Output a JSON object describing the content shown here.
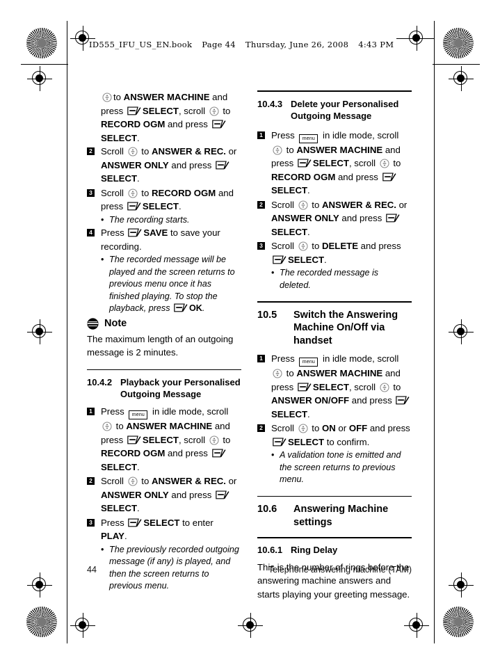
{
  "header": {
    "filename": "ID555_IFU_US_EN.book",
    "page_label": "Page 44",
    "day": "Thursday, June 26, 2008",
    "time": "4:43 PM"
  },
  "footer": {
    "page_number": "44",
    "chapter_title": "Telephone answering machine (TAM)"
  },
  "icons": {
    "scroll": "scroll-key-icon",
    "softkey": "soft-key-icon",
    "menu": "menu-key-icon",
    "menu_label": "menu",
    "note": "note-icon"
  },
  "left_column": {
    "continued_step": {
      "part1": "to ",
      "b1": "ANSWER MACHINE",
      "part2": " and press ",
      "b2": "SELECT",
      "part3": ", scroll ",
      "part4": " to ",
      "b3": "RECORD OGM",
      "part5": " and press ",
      "b4": "SELECT",
      "part6": "."
    },
    "steps": [
      {
        "num": "2",
        "segments": [
          {
            "t": "Scroll ",
            "bold": false
          },
          {
            "t": "ICON_SCROLL",
            "bold": false
          },
          {
            "t": " to ",
            "bold": false
          },
          {
            "t": "ANSWER & REC.",
            "bold": true
          },
          {
            "t": " or ",
            "bold": false
          },
          {
            "t": "ANSWER ONLY",
            "bold": true
          },
          {
            "t": " and press ",
            "bold": false
          },
          {
            "t": "ICON_SOFT",
            "bold": false
          },
          {
            "t": "SELECT",
            "bold": true
          },
          {
            "t": ".",
            "bold": false
          }
        ]
      },
      {
        "num": "3",
        "segments": [
          {
            "t": "Scroll ",
            "bold": false
          },
          {
            "t": "ICON_SCROLL",
            "bold": false
          },
          {
            "t": " to ",
            "bold": false
          },
          {
            "t": "RECORD OGM",
            "bold": true
          },
          {
            "t": " and press ",
            "bold": false
          },
          {
            "t": "ICON_SOFT",
            "bold": false
          },
          {
            "t": "SELECT",
            "bold": true
          },
          {
            "t": ".",
            "bold": false
          }
        ],
        "bullets": [
          "The recording starts."
        ]
      },
      {
        "num": "4",
        "segments": [
          {
            "t": "Press ",
            "bold": false
          },
          {
            "t": "ICON_SOFT",
            "bold": false
          },
          {
            "t": "SAVE",
            "bold": true
          },
          {
            "t": " to save your recording.",
            "bold": false
          }
        ],
        "bullets": []
      }
    ],
    "bullet_save": {
      "pre": "The recorded message will be played and the screen returns to previous menu once it has finished playing. To stop the playback, press ",
      "bold": "OK",
      "post": "."
    },
    "note": {
      "title": "Note",
      "body": "The maximum length of an outgoing message is 2 minutes."
    },
    "section_10_4_2": {
      "number": "10.4.2",
      "title": "Playback your Personalised Outgoing Message",
      "steps": [
        {
          "num": "1",
          "segments": [
            {
              "t": "Press ",
              "bold": false
            },
            {
              "t": "ICON_MENU",
              "bold": false
            },
            {
              "t": " in idle mode, scroll ",
              "bold": false
            },
            {
              "t": "ICON_SCROLL",
              "bold": false
            },
            {
              "t": " to ",
              "bold": false
            },
            {
              "t": "ANSWER MACHINE",
              "bold": true
            },
            {
              "t": " and press ",
              "bold": false
            },
            {
              "t": "ICON_SOFT",
              "bold": false
            },
            {
              "t": "SELECT",
              "bold": true
            },
            {
              "t": ", scroll ",
              "bold": false
            },
            {
              "t": "ICON_SCROLL",
              "bold": false
            },
            {
              "t": " to ",
              "bold": false
            },
            {
              "t": "RECORD OGM",
              "bold": true
            },
            {
              "t": " and press ",
              "bold": false
            },
            {
              "t": "ICON_SOFT",
              "bold": false
            },
            {
              "t": "SELECT",
              "bold": true
            },
            {
              "t": ".",
              "bold": false
            }
          ],
          "bullets": []
        },
        {
          "num": "2",
          "segments": [
            {
              "t": "Scroll ",
              "bold": false
            },
            {
              "t": "ICON_SCROLL",
              "bold": false
            },
            {
              "t": " to ",
              "bold": false
            },
            {
              "t": "ANSWER & REC.",
              "bold": true
            },
            {
              "t": " or ",
              "bold": false
            },
            {
              "t": "ANSWER ONLY",
              "bold": true
            },
            {
              "t": " and press ",
              "bold": false
            },
            {
              "t": "ICON_SOFT",
              "bold": false
            },
            {
              "t": "SELECT",
              "bold": true
            },
            {
              "t": ".",
              "bold": false
            }
          ],
          "bullets": []
        },
        {
          "num": "3",
          "segments": [
            {
              "t": "Press ",
              "bold": false
            },
            {
              "t": "ICON_SOFT",
              "bold": false
            },
            {
              "t": "SELECT",
              "bold": true
            },
            {
              "t": " to enter ",
              "bold": false
            },
            {
              "t": "PLAY",
              "bold": true
            },
            {
              "t": ".",
              "bold": false
            }
          ],
          "bullets": [
            "The previously recorded outgoing message (if any) is played, and then the screen returns to previous menu."
          ]
        }
      ]
    }
  },
  "right_column": {
    "section_10_4_3": {
      "number": "10.4.3",
      "title": "Delete your Personalised Outgoing Message",
      "steps": [
        {
          "num": "1",
          "segments": [
            {
              "t": "Press ",
              "bold": false
            },
            {
              "t": "ICON_MENU",
              "bold": false
            },
            {
              "t": " in idle mode, scroll ",
              "bold": false
            },
            {
              "t": "ICON_SCROLL",
              "bold": false
            },
            {
              "t": " to ",
              "bold": false
            },
            {
              "t": "ANSWER MACHINE",
              "bold": true
            },
            {
              "t": " and press ",
              "bold": false
            },
            {
              "t": "ICON_SOFT",
              "bold": false
            },
            {
              "t": "SELECT",
              "bold": true
            },
            {
              "t": ", scroll ",
              "bold": false
            },
            {
              "t": "ICON_SCROLL",
              "bold": false
            },
            {
              "t": " to ",
              "bold": false
            },
            {
              "t": "RECORD OGM",
              "bold": true
            },
            {
              "t": " and press ",
              "bold": false
            },
            {
              "t": "ICON_SOFT",
              "bold": false
            },
            {
              "t": "SELECT",
              "bold": true
            },
            {
              "t": ".",
              "bold": false
            }
          ],
          "bullets": []
        },
        {
          "num": "2",
          "segments": [
            {
              "t": "Scroll ",
              "bold": false
            },
            {
              "t": "ICON_SCROLL",
              "bold": false
            },
            {
              "t": " to ",
              "bold": false
            },
            {
              "t": "ANSWER & REC.",
              "bold": true
            },
            {
              "t": " or ",
              "bold": false
            },
            {
              "t": "ANSWER ONLY",
              "bold": true
            },
            {
              "t": " and press ",
              "bold": false
            },
            {
              "t": "ICON_SOFT",
              "bold": false
            },
            {
              "t": "SELECT",
              "bold": true
            },
            {
              "t": ".",
              "bold": false
            }
          ],
          "bullets": []
        },
        {
          "num": "3",
          "segments": [
            {
              "t": "Scroll ",
              "bold": false
            },
            {
              "t": "ICON_SCROLL",
              "bold": false
            },
            {
              "t": " to ",
              "bold": false
            },
            {
              "t": "DELETE",
              "bold": true
            },
            {
              "t": " and press ",
              "bold": false
            },
            {
              "t": "ICON_SOFT",
              "bold": false
            },
            {
              "t": "SELECT",
              "bold": true
            },
            {
              "t": ".",
              "bold": false
            }
          ],
          "bullets": [
            "The recorded message is deleted."
          ]
        }
      ]
    },
    "section_10_5": {
      "number": "10.5",
      "title": "Switch the Answering Machine On/Off via handset",
      "steps": [
        {
          "num": "1",
          "segments": [
            {
              "t": "Press ",
              "bold": false
            },
            {
              "t": "ICON_MENU",
              "bold": false
            },
            {
              "t": " in idle mode, scroll ",
              "bold": false
            },
            {
              "t": "ICON_SCROLL",
              "bold": false
            },
            {
              "t": " to ",
              "bold": false
            },
            {
              "t": "ANSWER MACHINE",
              "bold": true
            },
            {
              "t": " and press ",
              "bold": false
            },
            {
              "t": "ICON_SOFT",
              "bold": false
            },
            {
              "t": "SELECT",
              "bold": true
            },
            {
              "t": ", scroll ",
              "bold": false
            },
            {
              "t": "ICON_SCROLL",
              "bold": false
            },
            {
              "t": " to ",
              "bold": false
            },
            {
              "t": "ANSWER ON/OFF",
              "bold": true
            },
            {
              "t": " and press ",
              "bold": false
            },
            {
              "t": "ICON_SOFT",
              "bold": false
            },
            {
              "t": "SELECT",
              "bold": true
            },
            {
              "t": ".",
              "bold": false
            }
          ],
          "bullets": []
        },
        {
          "num": "2",
          "segments": [
            {
              "t": "Scroll ",
              "bold": false
            },
            {
              "t": "ICON_SCROLL",
              "bold": false
            },
            {
              "t": " to ",
              "bold": false
            },
            {
              "t": "ON",
              "bold": true
            },
            {
              "t": " or ",
              "bold": false
            },
            {
              "t": "OFF",
              "bold": true
            },
            {
              "t": " and press ",
              "bold": false
            },
            {
              "t": "ICON_SOFT",
              "bold": false
            },
            {
              "t": "SELECT",
              "bold": true
            },
            {
              "t": " to confirm.",
              "bold": false
            }
          ],
          "bullets": [
            "A validation tone is emitted and the screen returns to previous menu."
          ]
        }
      ]
    },
    "section_10_6": {
      "number": "10.6",
      "title": "Answering Machine settings"
    },
    "section_10_6_1": {
      "number": "10.6.1",
      "title": "Ring Delay",
      "body": "This is the number of rings before the answering machine answers and starts playing your greeting message."
    }
  }
}
